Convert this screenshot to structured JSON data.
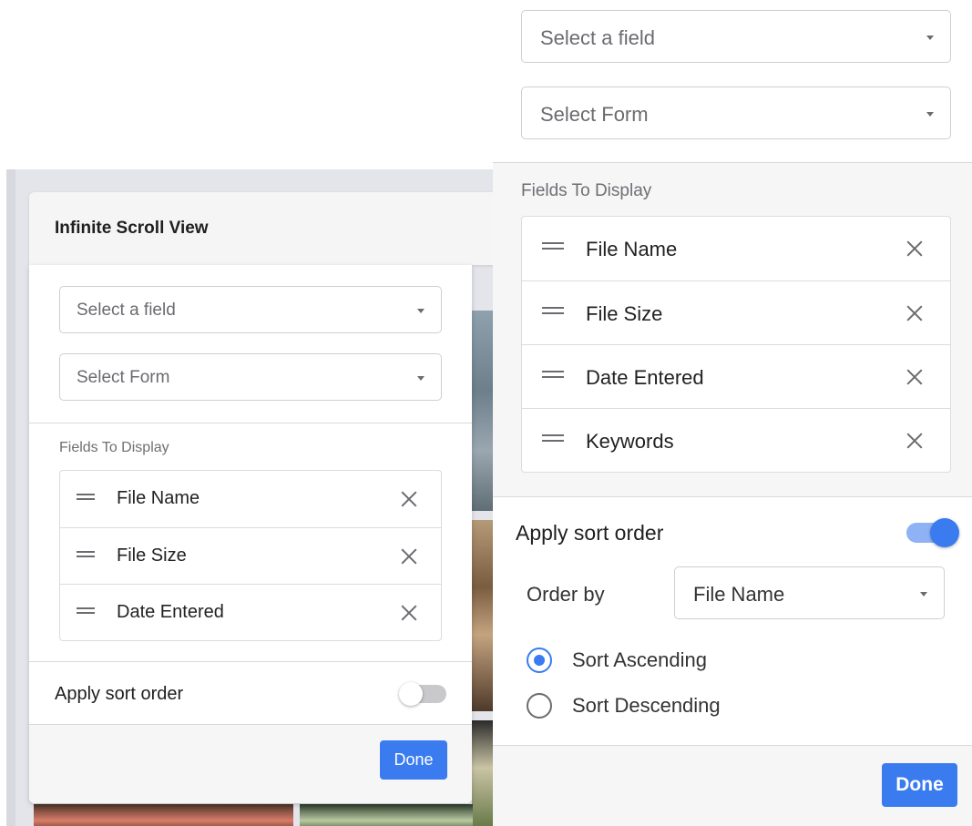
{
  "left": {
    "modal_title": "Infinite Scroll View",
    "field_select": {
      "placeholder": "Select a field"
    },
    "form_select": {
      "placeholder": "Select Form"
    },
    "fields_label": "Fields To Display",
    "fields": [
      "File Name",
      "File Size",
      "Date Entered"
    ],
    "sort": {
      "label": "Apply sort order",
      "enabled": false
    },
    "done_label": "Done"
  },
  "right": {
    "field_select": {
      "placeholder": "Select a field"
    },
    "form_select": {
      "placeholder": "Select Form"
    },
    "fields_label": "Fields To Display",
    "fields": [
      "File Name",
      "File Size",
      "Date Entered",
      "Keywords"
    ],
    "sort": {
      "label": "Apply sort order",
      "enabled": true,
      "order_by_label": "Order by",
      "order_by_value": "File Name",
      "options": [
        "Sort Ascending",
        "Sort Descending"
      ],
      "selected": "Sort Ascending"
    },
    "done_label": "Done"
  },
  "colors": {
    "accent": "#3b7bf0",
    "toggle_track_on": "#8fb2f5",
    "toggle_track_off": "#c9c9cc"
  }
}
